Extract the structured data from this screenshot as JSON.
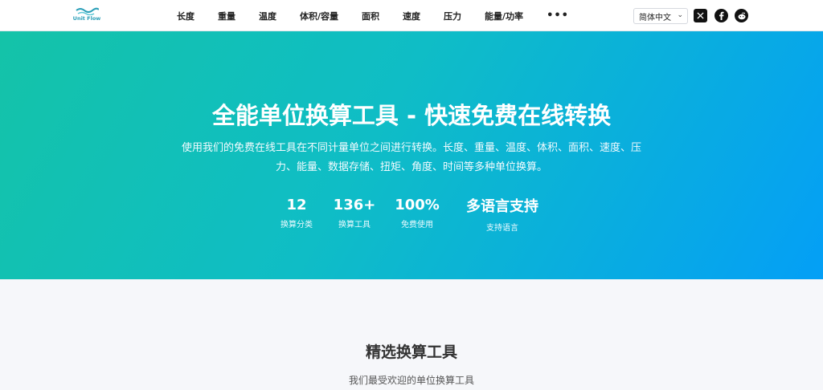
{
  "nav": {
    "logo_text": "Unit Flow",
    "items": [
      "长度",
      "重量",
      "温度",
      "体积/容量",
      "面积",
      "速度",
      "压力",
      "能量/功率"
    ],
    "more": "•••",
    "language": "简体中文",
    "social": [
      "x-icon",
      "facebook-icon",
      "reddit-icon"
    ]
  },
  "hero": {
    "title": "全能单位换算工具 - 快速免费在线转换",
    "description": "使用我们的免费在线工具在不同计量单位之间进行转换。长度、重量、温度、体积、面积、速度、压力、能量、数据存储、扭矩、角度、时间等多种单位换算。",
    "stats": [
      {
        "value": "12",
        "label": "换算分类"
      },
      {
        "value": "136+",
        "label": "换算工具"
      },
      {
        "value": "100%",
        "label": "免费使用"
      },
      {
        "value": "多语言支持",
        "label": "支持语言"
      }
    ]
  },
  "featured": {
    "title": "精选换算工具",
    "subtitle": "我们最受欢迎的单位换算工具"
  },
  "colors": {
    "hero_start": "#14c3a8",
    "hero_end": "#049ff6",
    "logo": "#2a9fb8"
  }
}
